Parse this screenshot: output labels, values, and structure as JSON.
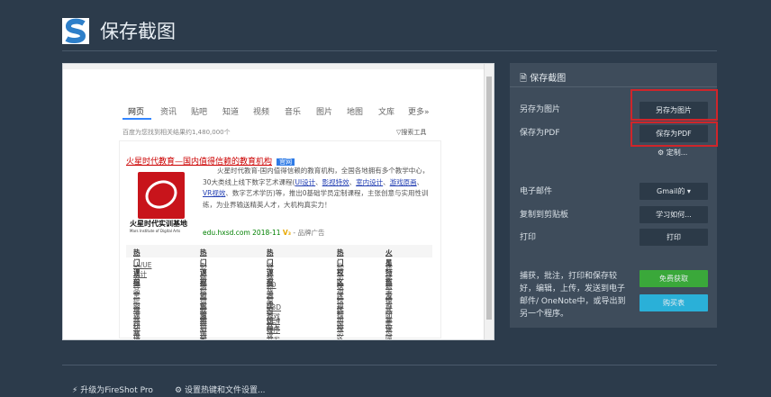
{
  "header": {
    "title": "保存截图",
    "logo_letter": "S"
  },
  "preview": {
    "tabs": [
      "网页",
      "资讯",
      "贴吧",
      "知道",
      "视频",
      "音乐",
      "图片",
      "地图",
      "文库",
      "更多»"
    ],
    "result_count": "百度为您找到相关结果约1,480,000个",
    "search_tools": "▽搜索工具",
    "ad": {
      "title": "火星时代教育—国内值得信赖的教育机构",
      "badge": "官网",
      "desc_1": "火星时代教育-国内值得信赖的教育机构，全国各地拥有多个教学中心，30大类线上线下数字艺术课程(",
      "link_1": "UI设计",
      "link_2": "影视特效",
      "link_3": "室内设计",
      "link_4": "游戏原画",
      "link_5": "VR视效",
      "desc_2": "数字艺术学历)等，推出0基础学员定制课程，主张创意与实用性训练，为业界输送精英人才，大机构真实力！",
      "brand_name": "火星时代实训基地",
      "brand_en": "Mars Institute of Digital Arts",
      "url": "edu.hxsd.com 2018-11",
      "v_badge": "V₃",
      "ad_label": "- 品牌广告"
    },
    "table": {
      "headers": [
        "热门课程",
        "热门课程",
        "热门课程",
        "热门校区",
        "火星特色"
      ],
      "rows": [
        [
          "UI/UE设计师",
          "影视剪辑包装",
          "游戏3D美术",
          "北京校区",
          "课程研发"
        ],
        [
          "产品经理",
          "影视特效师",
          "游戏原画设计",
          "上海校区",
          "教学模式"
        ],
        [
          "室内设计师",
          "影视剪辑大师",
          "游戏特效设计",
          "深圳校区",
          "师资团队"
        ],
        [
          "游戏UI设计",
          "影视后期合成",
          "U3D游戏开发",
          "杭州校区",
          "就业保障"
        ],
        [
          "商业插画师",
          "影视角色动画",
          "UE4程序开发",
          "南京校区",
          "学员成果"
        ]
      ]
    }
  },
  "panel": {
    "title": "保存截图",
    "rows": [
      {
        "label": "另存为图片",
        "button": "另存为图片"
      },
      {
        "label": "保存为PDF",
        "button": "保存为PDF"
      },
      {
        "label": "电子邮件",
        "button": "Gmail的 ▾"
      },
      {
        "label": "复制到剪贴板",
        "button": "学习如何..."
      },
      {
        "label": "打印",
        "button": "打印"
      }
    ],
    "customize": "定制...",
    "promo": "捕获，批注，打印和保存较好，编辑，上传，发送到电子邮件/ OneNote中，或导出到另一个程序。",
    "free_button": "免费获取",
    "buy_button": "购买表",
    "colors": {
      "green": "#3aa83a",
      "blue": "#2ab0d8",
      "highlight": "#d0252a"
    }
  },
  "footer": {
    "upgrade": "升级为FireShot Pro",
    "settings": "设置热键和文件设置..."
  }
}
